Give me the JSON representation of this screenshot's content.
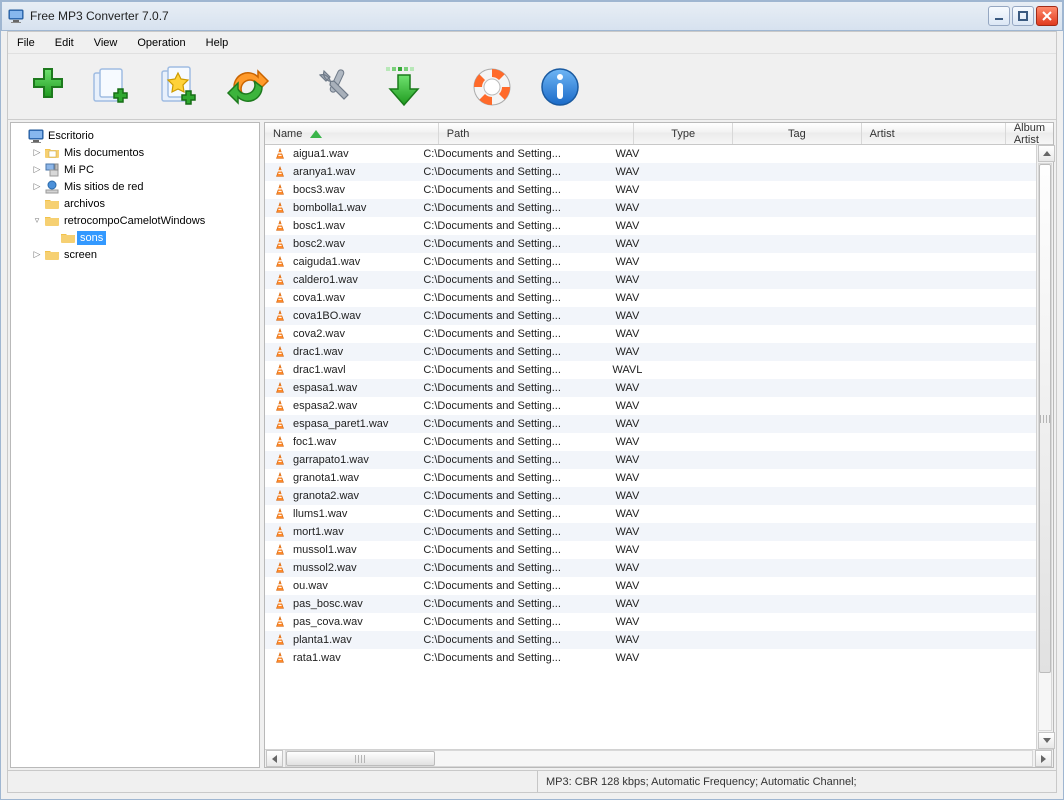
{
  "window": {
    "title": "Free MP3 Converter 7.0.7"
  },
  "menu": [
    "File",
    "Edit",
    "View",
    "Operation",
    "Help"
  ],
  "toolbar": [
    {
      "name": "add-files-button",
      "svg": "plus-green"
    },
    {
      "name": "add-folder-button",
      "svg": "folder-plus"
    },
    {
      "name": "favorites-button",
      "svg": "star-folder"
    },
    {
      "name": "convert-button",
      "svg": "refresh-orange"
    },
    {
      "name": "settings-button",
      "svg": "tools"
    },
    {
      "name": "download-button",
      "svg": "download-green"
    },
    {
      "name": "help-button",
      "svg": "lifebuoy"
    },
    {
      "name": "about-button",
      "svg": "info-blue"
    }
  ],
  "tree": {
    "root": {
      "label": "Escritorio",
      "icon": "monitor"
    },
    "children": [
      {
        "label": "Mis documentos",
        "icon": "folder-doc",
        "twisty": "▷"
      },
      {
        "label": "Mi PC",
        "icon": "pc",
        "twisty": "▷"
      },
      {
        "label": "Mis sitios de red",
        "icon": "network",
        "twisty": "▷"
      },
      {
        "label": "archivos",
        "icon": "folder",
        "twisty": ""
      },
      {
        "label": "retrocompoCamelotWindows",
        "icon": "folder",
        "twisty": "▿",
        "children": [
          {
            "label": "sons",
            "icon": "folder",
            "selected": true
          }
        ]
      },
      {
        "label": "screen",
        "icon": "folder",
        "twisty": "▷"
      }
    ]
  },
  "columns": [
    {
      "label": "Name",
      "cls": "w-name",
      "sort": true
    },
    {
      "label": "Path",
      "cls": "w-path"
    },
    {
      "label": "Type",
      "cls": "w-type",
      "center": true
    },
    {
      "label": "Tag",
      "cls": "w-tag",
      "center": true
    },
    {
      "label": "Artist",
      "cls": "w-artist"
    },
    {
      "label": "Album Artist",
      "cls": "w-albumartist"
    }
  ],
  "rows": [
    {
      "name": "aigua1.wav",
      "path": "C:\\Documents and Setting...",
      "type": "WAV"
    },
    {
      "name": "aranya1.wav",
      "path": "C:\\Documents and Setting...",
      "type": "WAV"
    },
    {
      "name": "bocs3.wav",
      "path": "C:\\Documents and Setting...",
      "type": "WAV"
    },
    {
      "name": "bombolla1.wav",
      "path": "C:\\Documents and Setting...",
      "type": "WAV"
    },
    {
      "name": "bosc1.wav",
      "path": "C:\\Documents and Setting...",
      "type": "WAV"
    },
    {
      "name": "bosc2.wav",
      "path": "C:\\Documents and Setting...",
      "type": "WAV"
    },
    {
      "name": "caiguda1.wav",
      "path": "C:\\Documents and Setting...",
      "type": "WAV"
    },
    {
      "name": "caldero1.wav",
      "path": "C:\\Documents and Setting...",
      "type": "WAV"
    },
    {
      "name": "cova1.wav",
      "path": "C:\\Documents and Setting...",
      "type": "WAV"
    },
    {
      "name": "cova1BO.wav",
      "path": "C:\\Documents and Setting...",
      "type": "WAV"
    },
    {
      "name": "cova2.wav",
      "path": "C:\\Documents and Setting...",
      "type": "WAV"
    },
    {
      "name": "drac1.wav",
      "path": "C:\\Documents and Setting...",
      "type": "WAV"
    },
    {
      "name": "drac1.wavl",
      "path": "C:\\Documents and Setting...",
      "type": "WAVL"
    },
    {
      "name": "espasa1.wav",
      "path": "C:\\Documents and Setting...",
      "type": "WAV"
    },
    {
      "name": "espasa2.wav",
      "path": "C:\\Documents and Setting...",
      "type": "WAV"
    },
    {
      "name": "espasa_paret1.wav",
      "path": "C:\\Documents and Setting...",
      "type": "WAV"
    },
    {
      "name": "foc1.wav",
      "path": "C:\\Documents and Setting...",
      "type": "WAV"
    },
    {
      "name": "garrapato1.wav",
      "path": "C:\\Documents and Setting...",
      "type": "WAV"
    },
    {
      "name": "granota1.wav",
      "path": "C:\\Documents and Setting...",
      "type": "WAV"
    },
    {
      "name": "granota2.wav",
      "path": "C:\\Documents and Setting...",
      "type": "WAV"
    },
    {
      "name": "llums1.wav",
      "path": "C:\\Documents and Setting...",
      "type": "WAV"
    },
    {
      "name": "mort1.wav",
      "path": "C:\\Documents and Setting...",
      "type": "WAV"
    },
    {
      "name": "mussol1.wav",
      "path": "C:\\Documents and Setting...",
      "type": "WAV"
    },
    {
      "name": "mussol2.wav",
      "path": "C:\\Documents and Setting...",
      "type": "WAV"
    },
    {
      "name": "ou.wav",
      "path": "C:\\Documents and Setting...",
      "type": "WAV"
    },
    {
      "name": "pas_bosc.wav",
      "path": "C:\\Documents and Setting...",
      "type": "WAV"
    },
    {
      "name": "pas_cova.wav",
      "path": "C:\\Documents and Setting...",
      "type": "WAV"
    },
    {
      "name": "planta1.wav",
      "path": "C:\\Documents and Setting...",
      "type": "WAV"
    },
    {
      "name": "rata1.wav",
      "path": "C:\\Documents and Setting...",
      "type": "WAV"
    }
  ],
  "statusbar": {
    "left": "",
    "right": "MP3:  CBR 128 kbps; Automatic Frequency; Automatic Channel;"
  }
}
